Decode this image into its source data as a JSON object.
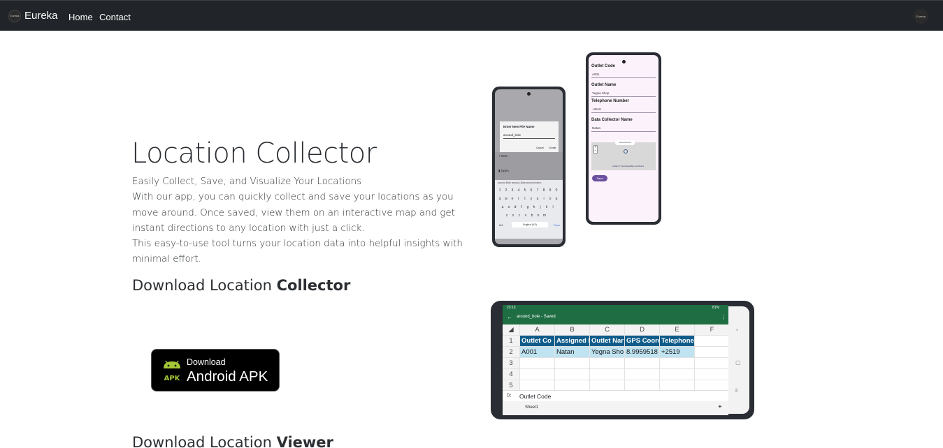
{
  "navbar": {
    "brand": "Eureka",
    "brand_logo_text": "Eureka",
    "links": [
      "Home",
      "Contact"
    ],
    "avatar_text": "Eureka"
  },
  "hero": {
    "title": "Location Collector",
    "tagline": "Easily Collect, Save, and Visualize Your Locations",
    "paragraph1": "With our app, you can quickly collect and save your locations as you move around. Once saved, view them on an interactive map and get instant directions to any location with just a click.",
    "paragraph2": "This easy-to-use tool turns your location data into helpful insights with minimal effort."
  },
  "download_collector": {
    "prefix": "Download Location ",
    "bold": "Collector"
  },
  "download_viewer": {
    "prefix": "Download Location ",
    "bold": "Viewer"
  },
  "apk_button": {
    "small": "Download",
    "big": "Android APK",
    "badge": "APK",
    "accent": "#a4c639"
  },
  "phone1": {
    "dialog_title": "Enter New File Name",
    "dialog_value": "around_bole",
    "cancel": "Cancel",
    "create": "Create",
    "menu_new": "New",
    "menu_open": "Open",
    "suggestions": "around Bole   around_Bole   around bolero",
    "key_rows": [
      [
        "1",
        "2",
        "3",
        "4",
        "5",
        "6",
        "7",
        "8",
        "9",
        "0"
      ],
      [
        "q",
        "w",
        "e",
        "r",
        "t",
        "y",
        "u",
        "i",
        "o",
        "p"
      ],
      [
        "a",
        "s",
        "d",
        "f",
        "g",
        "h",
        "j",
        "k",
        "l"
      ],
      [
        "z",
        "x",
        "c",
        "v",
        "b",
        "n",
        "m"
      ]
    ],
    "spacebar": "English (US)",
    "done": "Done",
    "symbols": "!#1"
  },
  "phone2": {
    "fields": [
      {
        "label": "Outlet Code",
        "value": "A001"
      },
      {
        "label": "Outlet Name",
        "value": "Yegna Shop"
      },
      {
        "label": "Telephone Number",
        "value": "+2519"
      },
      {
        "label": "Data Collector Name",
        "value": "Natan"
      }
    ],
    "map_popup": "You are here",
    "attribution": "Leaflet | © OpenStreetMap contributors",
    "save": "Save"
  },
  "phone3": {
    "status_time": "23:13",
    "status_battery": "81%",
    "file_title": "around_bole - Saved",
    "columns": [
      "A",
      "B",
      "C",
      "D",
      "E",
      "F"
    ],
    "rows": [
      "1",
      "2",
      "3",
      "4",
      "5"
    ],
    "header_row": [
      "Outlet Co",
      "Assigned D",
      "Outlet Nar",
      "GPS Coorc",
      "Telephone"
    ],
    "data_row": [
      "A001",
      "Natan",
      "Yegna Sho",
      "8.9959518",
      "+2519"
    ],
    "formula_label": "fx",
    "formula_value": "Outlet Code",
    "sheet": "Sheet1",
    "add_sheet": "+"
  }
}
